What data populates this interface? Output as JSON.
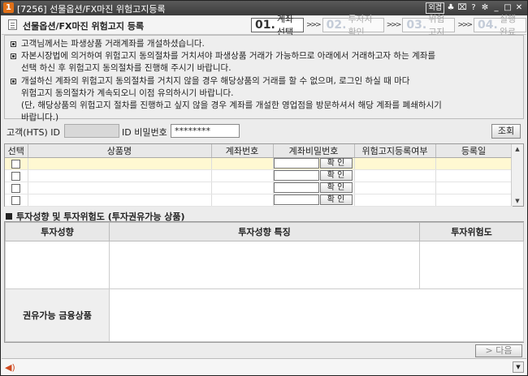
{
  "window": {
    "icon_text": "1",
    "title": "[7256] 선물옵션/FX마진 위험고지등록",
    "controls": [
      "외겹",
      "♣",
      "⌧",
      "?",
      "✼",
      "_",
      "□",
      "✕"
    ]
  },
  "header": {
    "title": "선물옵션/FX마진 위험고지 등록"
  },
  "steps": [
    {
      "num": "01.",
      "label": "계좌선택"
    },
    {
      "num": "02.",
      "label": "투자자 확인"
    },
    {
      "num": "03.",
      "label": "위험고지"
    },
    {
      "num": "04.",
      "label": "실행완료"
    }
  ],
  "notice": {
    "line1": "고객님께서는 파생상품 거래계좌를 개설하셨습니다.",
    "line2": "자본시장법에 의거하여 위험고지 동의절차를 거치셔야 파생상품 거래가 가능하므로 아래에서 거래하고자 하는 계좌를",
    "line3": "선택 하신 후 위험고지 동의절차를 진행해 주시기 바랍니다.",
    "line4": "개설하신 계좌의 위험고지 동의절차를 거치지 않을 경우 해당상품의 거래를 할 수 없으며, 로그인 하실 때 마다",
    "line5": "위험고지 동의절차가 계속되오니 이점 유의하시기 바랍니다.",
    "line6": "(단, 해당상품의 위험고지 절차를 진행하고 싶지 않을 경우 계좌를 개설한 영업점을 방문하셔서 해당 계좌를 폐쇄하시기",
    "line7": "바랍니다.)"
  },
  "idrow": {
    "id_label": "고객(HTS) ID",
    "id_value": "",
    "pw_label": "ID 비밀번호",
    "pw_value": "********",
    "search_label": "조회"
  },
  "grid": {
    "headers": [
      "선택",
      "상품명",
      "계좌번호",
      "계좌비밀번호",
      "위험고지등록여부",
      "등록일"
    ],
    "confirm_label": "확 인"
  },
  "section": {
    "title": "투자성향 및 투자위험도 (투자권유가능 상품)"
  },
  "invest_table": {
    "headers": [
      "투자성향",
      "투자성향 특징",
      "투자위험도"
    ],
    "products_label": "권유가능 금융상품"
  },
  "next_label": "> 다음",
  "status": {
    "text": ""
  }
}
